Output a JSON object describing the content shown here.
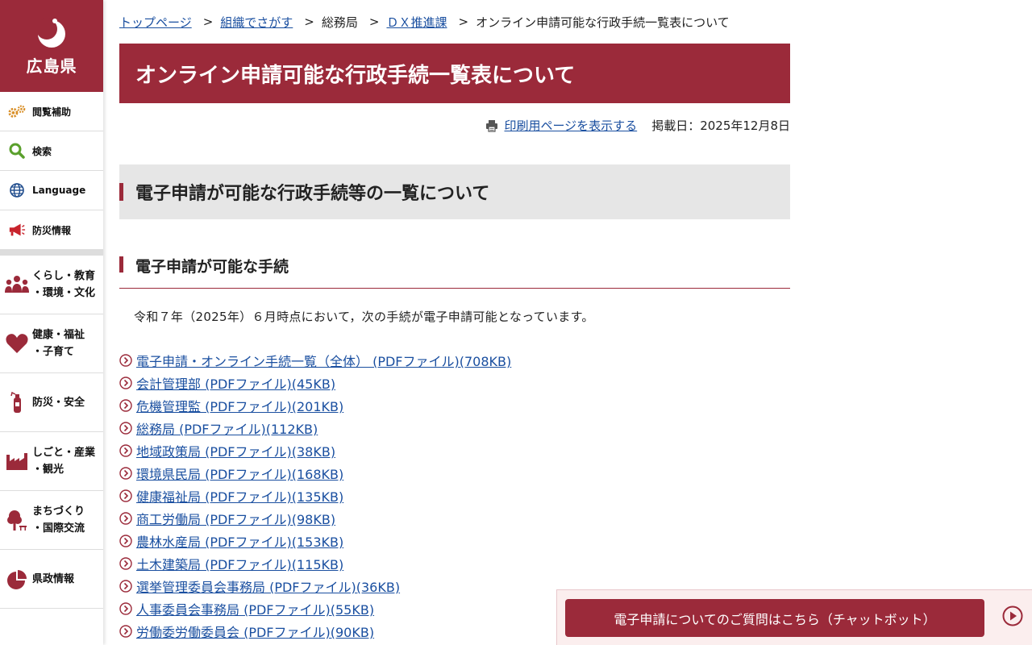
{
  "logo": {
    "text": "広島県"
  },
  "sidebar": {
    "utilities": [
      {
        "label": "閲覧補助",
        "icon": "gears-icon"
      },
      {
        "label": "検索",
        "icon": "search-icon"
      },
      {
        "label": "Language",
        "icon": "globe-icon"
      },
      {
        "label": "防災情報",
        "icon": "megaphone-icon"
      }
    ],
    "categories": [
      {
        "line1": "くらし・教育",
        "line2": "・環境・文化",
        "icon": "people-icon"
      },
      {
        "line1": "健康・福祉",
        "line2": "・子育て",
        "icon": "heart-icon"
      },
      {
        "line1": "防災・安全",
        "line2": "",
        "icon": "fire-extinguisher-icon"
      },
      {
        "line1": "しごと・産業",
        "line2": "・観光",
        "icon": "factory-icon"
      },
      {
        "line1": "まちづくり",
        "line2": "・国際交流",
        "icon": "tree-icon"
      },
      {
        "line1": "県政情報",
        "line2": "",
        "icon": "pie-chart-icon"
      }
    ]
  },
  "breadcrumb": {
    "items": [
      "トップページ",
      "組織でさがす",
      "総務局",
      "ＤＸ推進課",
      "オンライン申請可能な行政手続一覧表について"
    ],
    "separator": ">"
  },
  "page": {
    "title": "オンライン申請可能な行政手続一覧表について",
    "print_label": "印刷用ページを表示する",
    "date_label": "掲載日：2025年12月8日",
    "heading2": "電子申請が可能な行政手続等の一覧について",
    "heading3": "電子申請が可能な手続",
    "intro": "令和７年（2025年）６月時点において，次の手続が電子申請可能となっています。"
  },
  "links": [
    "電子申請・オンライン手続一覧（全体） (PDFファイル)(708KB)",
    "会計管理部 (PDFファイル)(45KB)",
    "危機管理監 (PDFファイル)(201KB)",
    "総務局 (PDFファイル)(112KB)",
    "地域政策局 (PDFファイル)(38KB)",
    "環境県民局 (PDFファイル)(168KB)",
    "健康福祉局 (PDFファイル)(135KB)",
    "商工労働局 (PDFファイル)(98KB)",
    "農林水産局 (PDFファイル)(153KB)",
    "土木建築局 (PDFファイル)(115KB)",
    "選挙管理委員会事務局 (PDFファイル)(36KB)",
    "人事委員会事務局 (PDFファイル)(55KB)",
    "労働委労働委員会 (PDFファイル)(90KB)"
  ],
  "chatbot": {
    "label": "電子申請についてのご質問はこちら（チャットボット）"
  },
  "colors": {
    "brand": "#9b2a3a",
    "link": "#1a4fa0",
    "heading_bg": "#e6e6e6",
    "chat_bg": "#fbeeee"
  }
}
